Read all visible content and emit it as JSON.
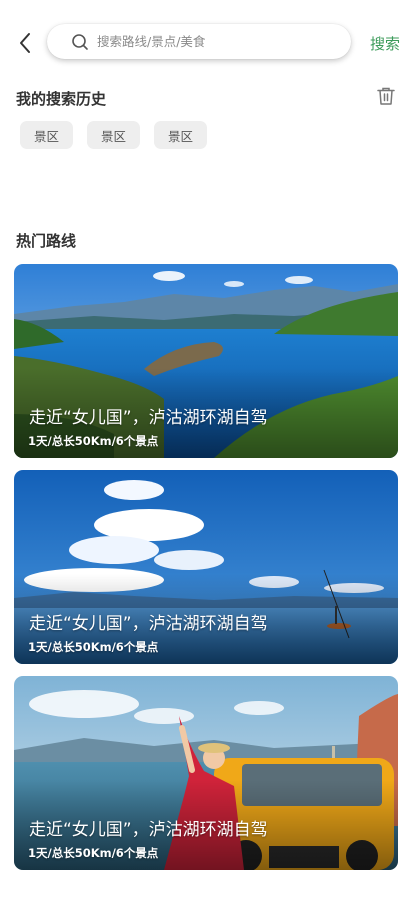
{
  "search": {
    "placeholder": "搜索路线/景点/美食",
    "action_label": "搜索"
  },
  "history": {
    "title": "我的搜索历史",
    "tags": [
      "景区",
      "景区",
      "景区"
    ]
  },
  "routes": {
    "title": "热门路线",
    "items": [
      {
        "title": "走近“女儿国”，泸沽湖环湖自驾",
        "subtitle": "1天/总长50Km/6个景点"
      },
      {
        "title": "走近“女儿国”，泸沽湖环湖自驾",
        "subtitle": "1天/总长50Km/6个景点"
      },
      {
        "title": "走近“女儿国”，泸沽湖环湖自驾",
        "subtitle": "1天/总长50Km/6个景点"
      }
    ]
  },
  "icons": {
    "back": "chevron-left-icon",
    "search": "search-icon",
    "trash": "trash-icon"
  },
  "colors": {
    "accent": "#3c9b5a",
    "tag_bg": "#eeeeee"
  }
}
